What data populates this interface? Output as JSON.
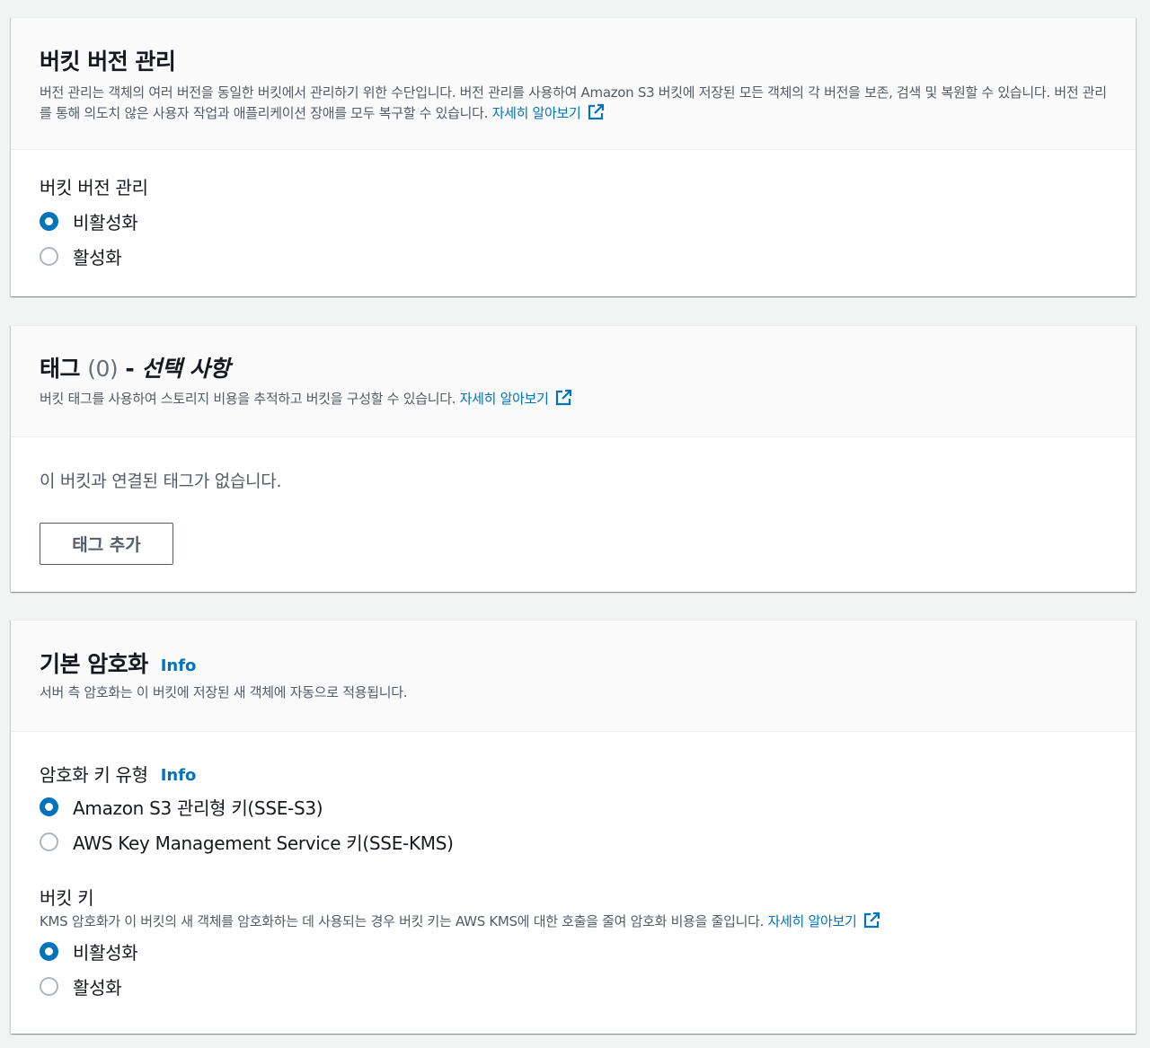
{
  "versioning": {
    "title": "버킷 버전 관리",
    "description": "버전 관리는 객체의 여러 버전을 동일한 버킷에서 관리하기 위한 수단입니다. 버전 관리를 사용하여 Amazon S3 버킷에 저장된 모든 객체의 각 버전을 보존, 검색 및 복원할 수 있습니다. 버전 관리를 통해 의도치 않은 사용자 작업과 애플리케이션 장애를 모두 복구할 수 있습니다.",
    "learn_more": "자세히 알아보기",
    "field_label": "버킷 버전 관리",
    "options": [
      "비활성화",
      "활성화"
    ],
    "selected": "비활성화"
  },
  "tags": {
    "title": "태그",
    "count": "(0)",
    "separator": "-",
    "optional": "선택 사항",
    "description": "버킷 태그를 사용하여 스토리지 비용을 추적하고 버킷을 구성할 수 있습니다.",
    "learn_more": "자세히 알아보기",
    "empty_text": "이 버킷과 연결된 태그가 없습니다.",
    "add_button": "태그 추가"
  },
  "encryption": {
    "title": "기본 암호화",
    "info": "Info",
    "description": "서버 측 암호화는 이 버킷에 저장된 새 객체에 자동으로 적용됩니다.",
    "key_type_label": "암호화 키 유형",
    "key_type_info": "Info",
    "key_type_options": [
      "Amazon S3 관리형 키(SSE-S3)",
      "AWS Key Management Service 키(SSE-KMS)"
    ],
    "key_type_selected": "Amazon S3 관리형 키(SSE-S3)",
    "bucket_key_label": "버킷 키",
    "bucket_key_description": "KMS 암호화가 이 버킷의 새 객체를 암호화하는 데 사용되는 경우 버킷 키는 AWS KMS에 대한 호출을 줄여 암호화 비용을 줄입니다.",
    "bucket_key_learn_more": "자세히 알아보기",
    "bucket_key_options": [
      "비활성화",
      "활성화"
    ],
    "bucket_key_selected": "비활성화"
  },
  "colors": {
    "accent": "#0073bb",
    "page_bg": "#f2f3f3",
    "header_bg": "#fafafa"
  }
}
